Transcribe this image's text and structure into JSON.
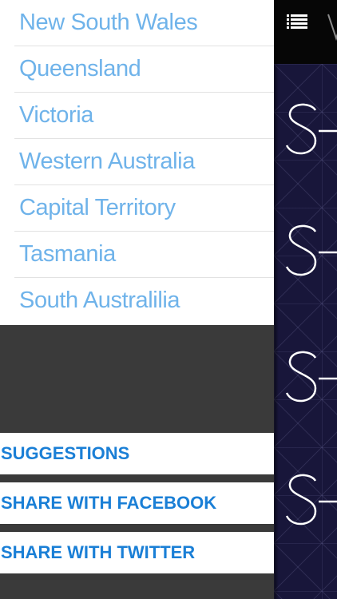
{
  "drawer": {
    "states": [
      {
        "label": "New South Wales"
      },
      {
        "label": "Queensland"
      },
      {
        "label": "Victoria"
      },
      {
        "label": "Western Australia"
      },
      {
        "label": "Capital Territory"
      },
      {
        "label": "Tasmania"
      },
      {
        "label": "South Australilia"
      }
    ],
    "actions": {
      "suggestions": "SUGGESTIONS",
      "share_facebook": "SHARE WITH FACEBOOK",
      "share_twitter": "SHARE WITH TWITTER"
    }
  },
  "main": {
    "menu_icon": "list-menu-icon",
    "tiles": [
      "S-icon",
      "S-icon",
      "S-icon",
      "S-icon"
    ]
  },
  "colors": {
    "state_text": "#6fb3ea",
    "action_text": "#1a7fd6",
    "drawer_bg": "#3a3a3a",
    "header_bg": "#060606",
    "main_bg": "#18163a"
  }
}
